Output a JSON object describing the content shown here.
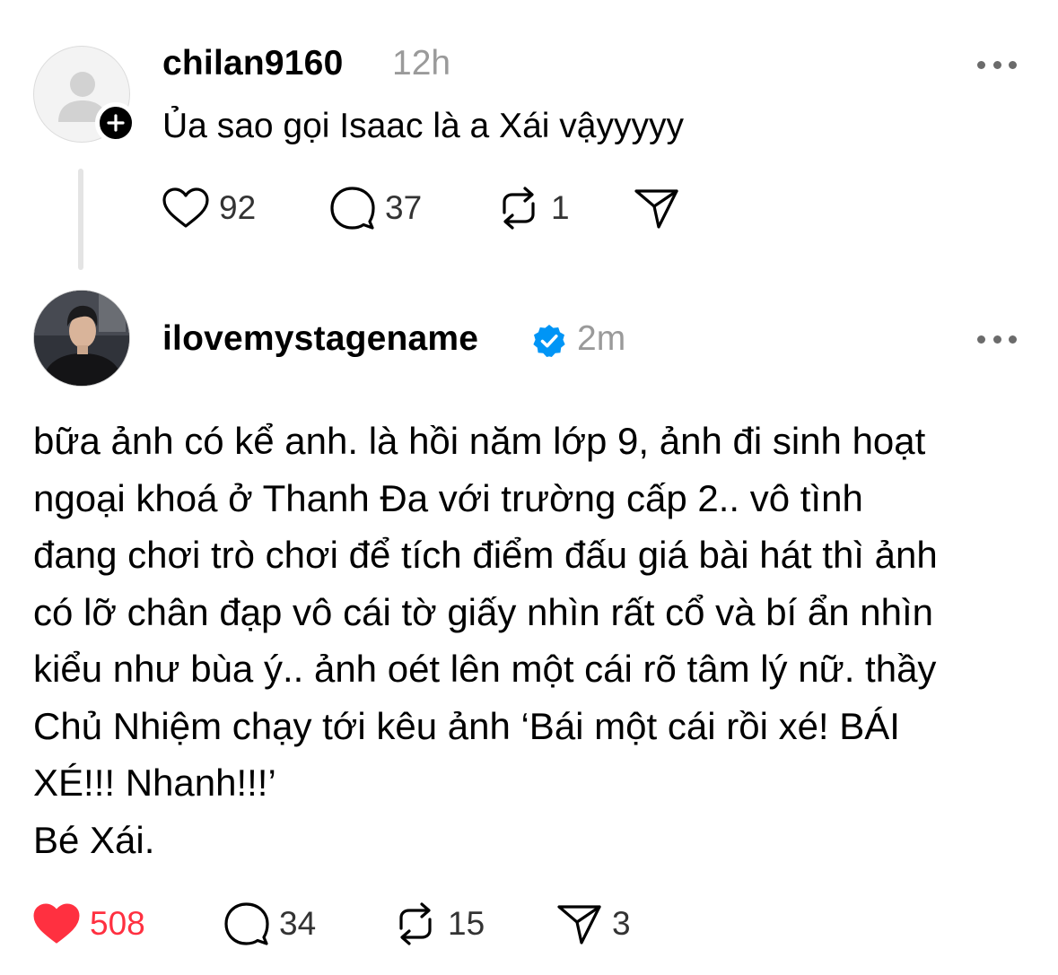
{
  "post1": {
    "username": "chilan9160",
    "time": "12h",
    "text": "Ủa sao gọi Isaac là a Xái vậyyyyy",
    "likes": "92",
    "comments": "37",
    "reposts": "1"
  },
  "post2": {
    "username": "ilovemystagename",
    "time": "2m",
    "verified": true,
    "lines": [
      "bữa ảnh có kể anh. là hồi năm lớp 9, ảnh đi sinh hoạt",
      "ngoại khoá ở Thanh Đa với trường cấp 2.. vô tình",
      "đang chơi trò chơi để tích điểm đấu giá bài hát thì ảnh",
      "có lỡ chân đạp vô cái tờ giấy nhìn rất cổ và bí ẩn nhìn",
      "kiểu như bùa ý.. ảnh oét lên một cái rõ tâm lý nữ. thầy",
      "Chủ Nhiệm chạy tới kêu ảnh ‘Bái một cái rồi xé! BÁI",
      "XÉ!!! Nhanh!!!’",
      "Bé Xái."
    ],
    "likes": "508",
    "liked": true,
    "comments": "34",
    "reposts": "15",
    "shares": "3"
  },
  "colors": {
    "like_active": "#ff3040",
    "verified_badge": "#0095f6",
    "muted_text": "#9a9a9a"
  },
  "icons": [
    "heart-icon",
    "comment-icon",
    "repost-icon",
    "share-icon",
    "more-icon",
    "plus-icon",
    "verified-badge-icon",
    "default-avatar-icon"
  ]
}
